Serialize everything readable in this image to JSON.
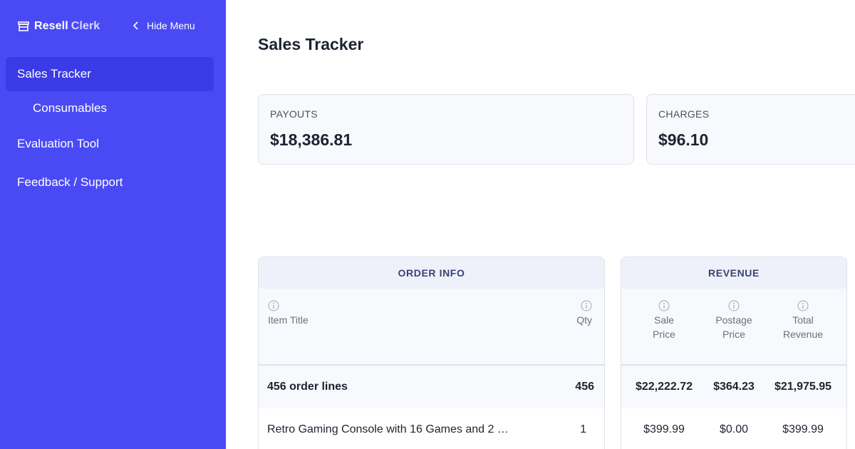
{
  "sidebar": {
    "brand": {
      "name_part1": "Resell",
      "name_part2": "Clerk",
      "icon": "store-icon"
    },
    "hide_menu_label": "Hide Menu",
    "items": [
      {
        "label": "Sales Tracker",
        "active": true
      },
      {
        "label": "Consumables",
        "active": false
      },
      {
        "label": "Evaluation Tool",
        "active": false
      },
      {
        "label": "Feedback / Support",
        "active": false
      }
    ]
  },
  "main": {
    "title": "Sales Tracker",
    "stats": [
      {
        "label": "PAYOUTS",
        "value": "$18,386.81"
      },
      {
        "label": "CHARGES",
        "value": "$96.10"
      }
    ],
    "table": {
      "groups": [
        {
          "label": "ORDER INFO",
          "columns": [
            "Item Title",
            "Qty"
          ]
        },
        {
          "label": "REVENUE",
          "columns": [
            [
              "Sale",
              "Price"
            ],
            [
              "Postage",
              "Price"
            ],
            [
              "Total",
              "Revenue"
            ]
          ]
        }
      ],
      "totals": {
        "item_title": "456 order lines",
        "qty": "456",
        "sale_price": "$22,222.72",
        "postage_price": "$364.23",
        "total_revenue": "$21,975.95"
      },
      "rows": [
        {
          "item_title": "Retro Gaming Console with 16 Games and 2 …",
          "qty": "1",
          "sale_price": "$399.99",
          "postage_price": "$0.00",
          "total_revenue": "$399.99"
        }
      ]
    }
  },
  "colors": {
    "sidebar_bg": "#4a4af5",
    "sidebar_active": "#3a3ae6",
    "group_header_bg": "#eef1fa",
    "group_header_text": "#3a4272"
  }
}
